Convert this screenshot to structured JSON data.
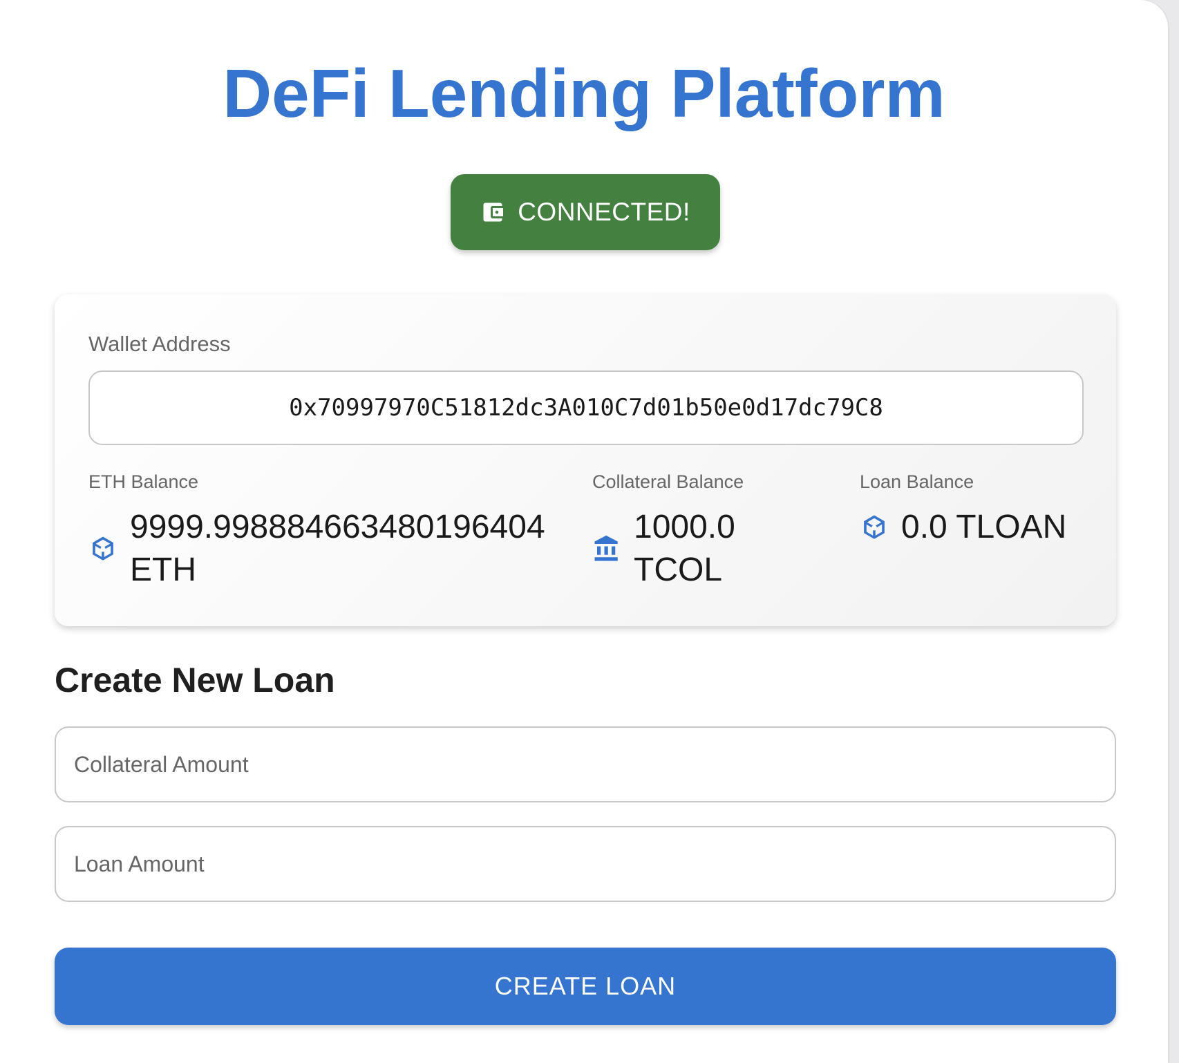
{
  "app": {
    "title": "DeFi Lending Platform"
  },
  "wallet_button": {
    "label": "CONNECTED!",
    "icon": "wallet-icon",
    "color": "#44803f"
  },
  "account": {
    "wallet_label": "Wallet Address",
    "wallet_address": "0x70997970C51812dc3A010C7d01b50e0d17dc79C8",
    "balances": [
      {
        "label": "ETH Balance",
        "value": "9999.998884663480196404 ETH",
        "icon": "cube-icon"
      },
      {
        "label": "Collateral Balance",
        "value": "1000.0 TCOL",
        "icon": "bank-icon"
      },
      {
        "label": "Loan Balance",
        "value": "0.0 TLOAN",
        "icon": "cube-icon"
      }
    ]
  },
  "loan_form": {
    "heading": "Create New Loan",
    "collateral_placeholder": "Collateral Amount",
    "loan_placeholder": "Loan Amount",
    "submit_label": "CREATE LOAN"
  },
  "colors": {
    "primary": "#3675cf",
    "success": "#44803f"
  }
}
